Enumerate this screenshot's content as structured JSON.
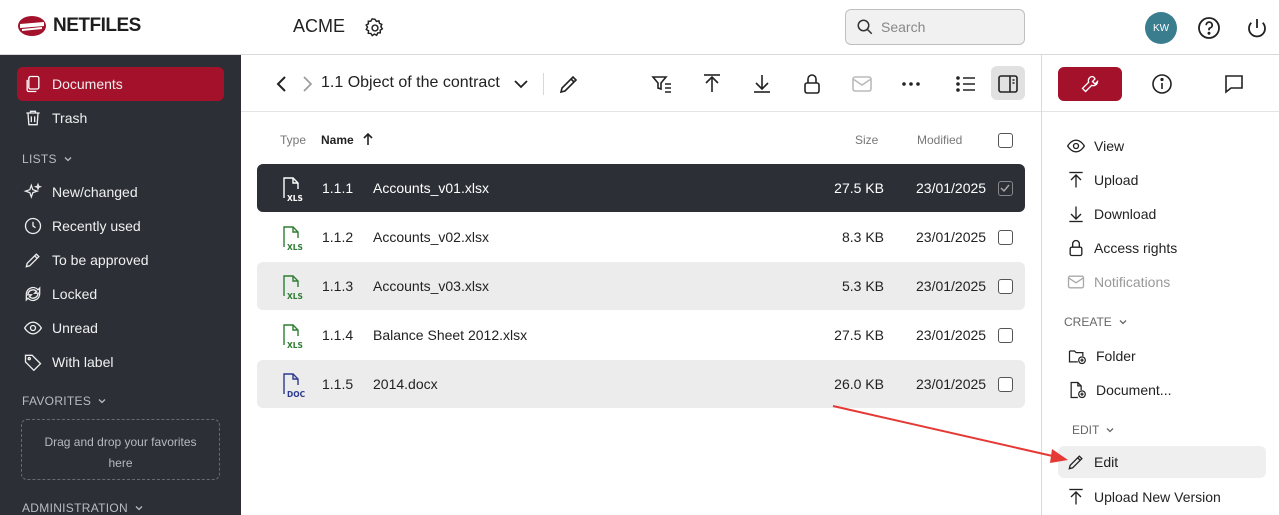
{
  "header": {
    "logo_text": "NETFILES",
    "company": "ACME",
    "search_placeholder": "Search",
    "avatar_initials": "KW"
  },
  "sidebar": {
    "top_items": [
      {
        "label": "Documents",
        "icon": "documents-icon",
        "active": true
      },
      {
        "label": "Trash",
        "icon": "trash-icon"
      }
    ],
    "lists_title": "LISTS",
    "lists": [
      {
        "label": "New/changed",
        "icon": "sparkle-icon"
      },
      {
        "label": "Recently used",
        "icon": "clock-icon"
      },
      {
        "label": "To be approved",
        "icon": "pencil-icon"
      },
      {
        "label": "Locked",
        "icon": "refresh-icon"
      },
      {
        "label": "Unread",
        "icon": "eye-icon"
      },
      {
        "label": "With label",
        "icon": "tag-icon"
      }
    ],
    "favorites_title": "FAVORITES",
    "favorites_drop_text": "Drag and drop your favorites here",
    "administration_title": "ADMINISTRATION"
  },
  "main": {
    "folder_title": "1.1 Object of the contract",
    "columns": {
      "type": "Type",
      "name": "Name",
      "size": "Size",
      "modified": "Modified"
    },
    "rows": [
      {
        "num": "1.1.1",
        "name": "Accounts_v01.xlsx",
        "size": "27.5 KB",
        "modified": "23/01/2025",
        "type": "XLS",
        "state": "selected"
      },
      {
        "num": "1.1.2",
        "name": "Accounts_v02.xlsx",
        "size": "8.3 KB",
        "modified": "23/01/2025",
        "type": "XLS",
        "state": "plain"
      },
      {
        "num": "1.1.3",
        "name": "Accounts_v03.xlsx",
        "size": "5.3 KB",
        "modified": "23/01/2025",
        "type": "XLS",
        "state": "gray"
      },
      {
        "num": "1.1.4",
        "name": "Balance Sheet 2012.xlsx",
        "size": "27.5 KB",
        "modified": "23/01/2025",
        "type": "XLS",
        "state": "plain"
      },
      {
        "num": "1.1.5",
        "name": "2014.docx",
        "size": "26.0 KB",
        "modified": "23/01/2025",
        "type": "DOC",
        "state": "gray"
      }
    ]
  },
  "right_panel": {
    "actions": [
      {
        "label": "View",
        "icon": "eye-icon"
      },
      {
        "label": "Upload",
        "icon": "upload-icon"
      },
      {
        "label": "Download",
        "icon": "download-icon"
      },
      {
        "label": "Access rights",
        "icon": "lock-icon"
      },
      {
        "label": "Notifications",
        "icon": "mail-icon",
        "disabled": true
      }
    ],
    "create_title": "CREATE",
    "create": [
      {
        "label": "Folder",
        "icon": "folder-plus-icon"
      },
      {
        "label": "Document...",
        "icon": "document-plus-icon"
      }
    ],
    "edit_title": "EDIT",
    "edit": [
      {
        "label": "Edit",
        "icon": "pencil-icon",
        "highlighted": true
      },
      {
        "label": "Upload New Version",
        "icon": "upload-icon"
      }
    ]
  },
  "colors": {
    "brand": "#a3112b",
    "sidebar_bg": "#2c2f36",
    "xls_green": "#2e7d32",
    "doc_blue": "#2b3a8f",
    "annotation_arrow": "#e53935"
  }
}
